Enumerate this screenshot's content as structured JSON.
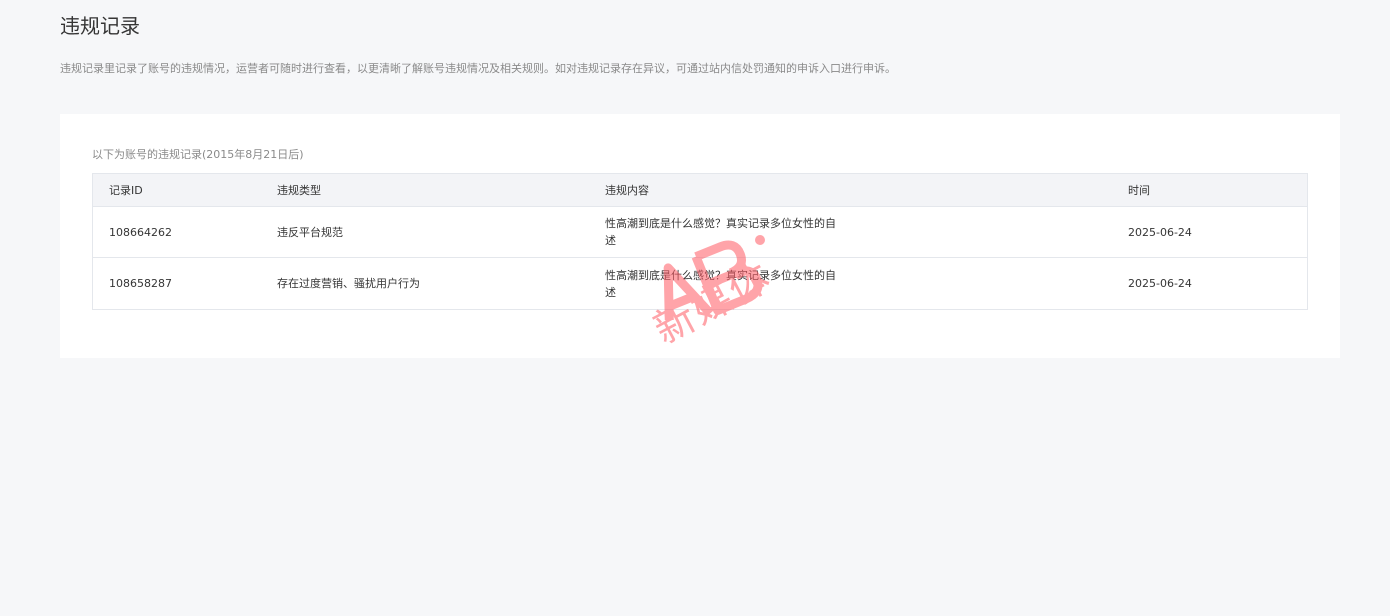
{
  "page": {
    "title": "违规记录",
    "description": "违规记录里记录了账号的违规情况，运营者可随时进行查看，以更清晰了解账号违规情况及相关规则。如对违规记录存在异议，可通过站内信处罚通知的申诉入口进行申诉。"
  },
  "card": {
    "caption": "以下为账号的违规记录(2015年8月21日后)",
    "columns": [
      "记录ID",
      "违规类型",
      "违规内容",
      "时间"
    ],
    "rows": [
      {
        "id": "108664262",
        "type": "违反平台规范",
        "content": "性高潮到底是什么感觉？真实记录多位女性的自述",
        "time": "2025-06-24"
      },
      {
        "id": "108658287",
        "type": "存在过度营销、骚扰用户行为",
        "content": "性高潮到底是什么感觉？真实记录多位女性的自述",
        "time": "2025-06-24"
      }
    ]
  },
  "watermark": {
    "logo_text": "AB",
    "text": "新媒体",
    "color": "#ff5a64"
  }
}
